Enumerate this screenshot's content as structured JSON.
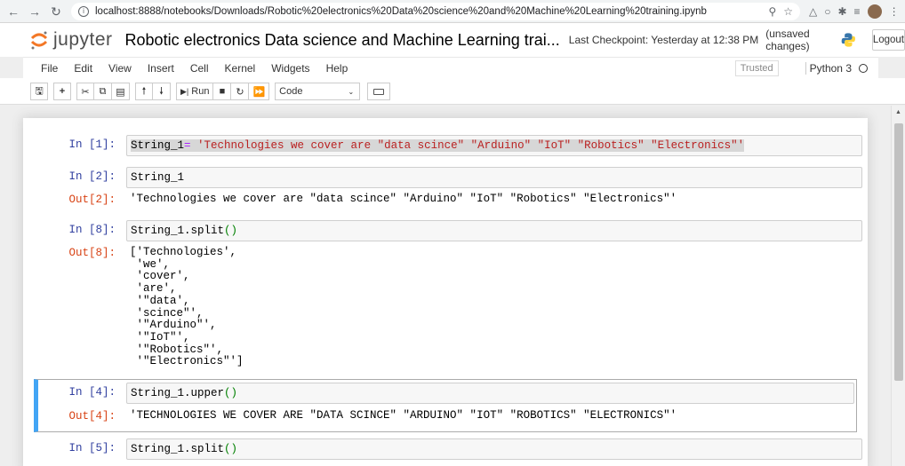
{
  "browser": {
    "url": "localhost:8888/notebooks/Downloads/Robotic%20electronics%20Data%20science%20and%20Machine%20Learning%20training.ipynb"
  },
  "header": {
    "logo_text": "jupyter",
    "notebook_title": "Robotic electronics Data science and Machine Learning trai...",
    "checkpoint": "Last Checkpoint: Yesterday at 12:38 PM",
    "unsaved": "(unsaved changes)",
    "logout_label": "Logout"
  },
  "menu": {
    "items": [
      "File",
      "Edit",
      "View",
      "Insert",
      "Cell",
      "Kernel",
      "Widgets",
      "Help"
    ],
    "trusted": "Trusted",
    "kernel": "Python 3"
  },
  "toolbar": {
    "run_label": "Run",
    "cell_type": "Code"
  },
  "cells": {
    "c1": {
      "in_prompt": "In [1]:",
      "code_var": "String_1",
      "code_op": "=",
      "code_str": " 'Technologies we cover are \"data scince\" \"Arduino\" \"IoT\" \"Robotics\" \"Electronics\"'"
    },
    "c2": {
      "in_prompt": "In [2]:",
      "code": "String_1",
      "out_prompt": "Out[2]:",
      "output": "'Technologies we cover are \"data scince\" \"Arduino\" \"IoT\" \"Robotics\" \"Electronics\"'"
    },
    "c3": {
      "in_prompt": "In [8]:",
      "code_main": "String_1.split",
      "code_paren": "()",
      "out_prompt": "Out[8]:",
      "output": "['Technologies',\n 'we',\n 'cover',\n 'are',\n '\"data',\n 'scince\"',\n '\"Arduino\"',\n '\"IoT\"',\n '\"Robotics\"',\n '\"Electronics\"']"
    },
    "c4": {
      "in_prompt": "In [4]:",
      "code_main": "String_1.upper",
      "code_paren": "()",
      "out_prompt": "Out[4]:",
      "output": "'TECHNOLOGIES WE COVER ARE \"DATA SCINCE\" \"ARDUINO\" \"IOT\" \"ROBOTICS\" \"ELECTRONICS\"'"
    },
    "c5": {
      "in_prompt": "In [5]:",
      "code_main": "String_1.split",
      "code_paren": "()"
    }
  }
}
